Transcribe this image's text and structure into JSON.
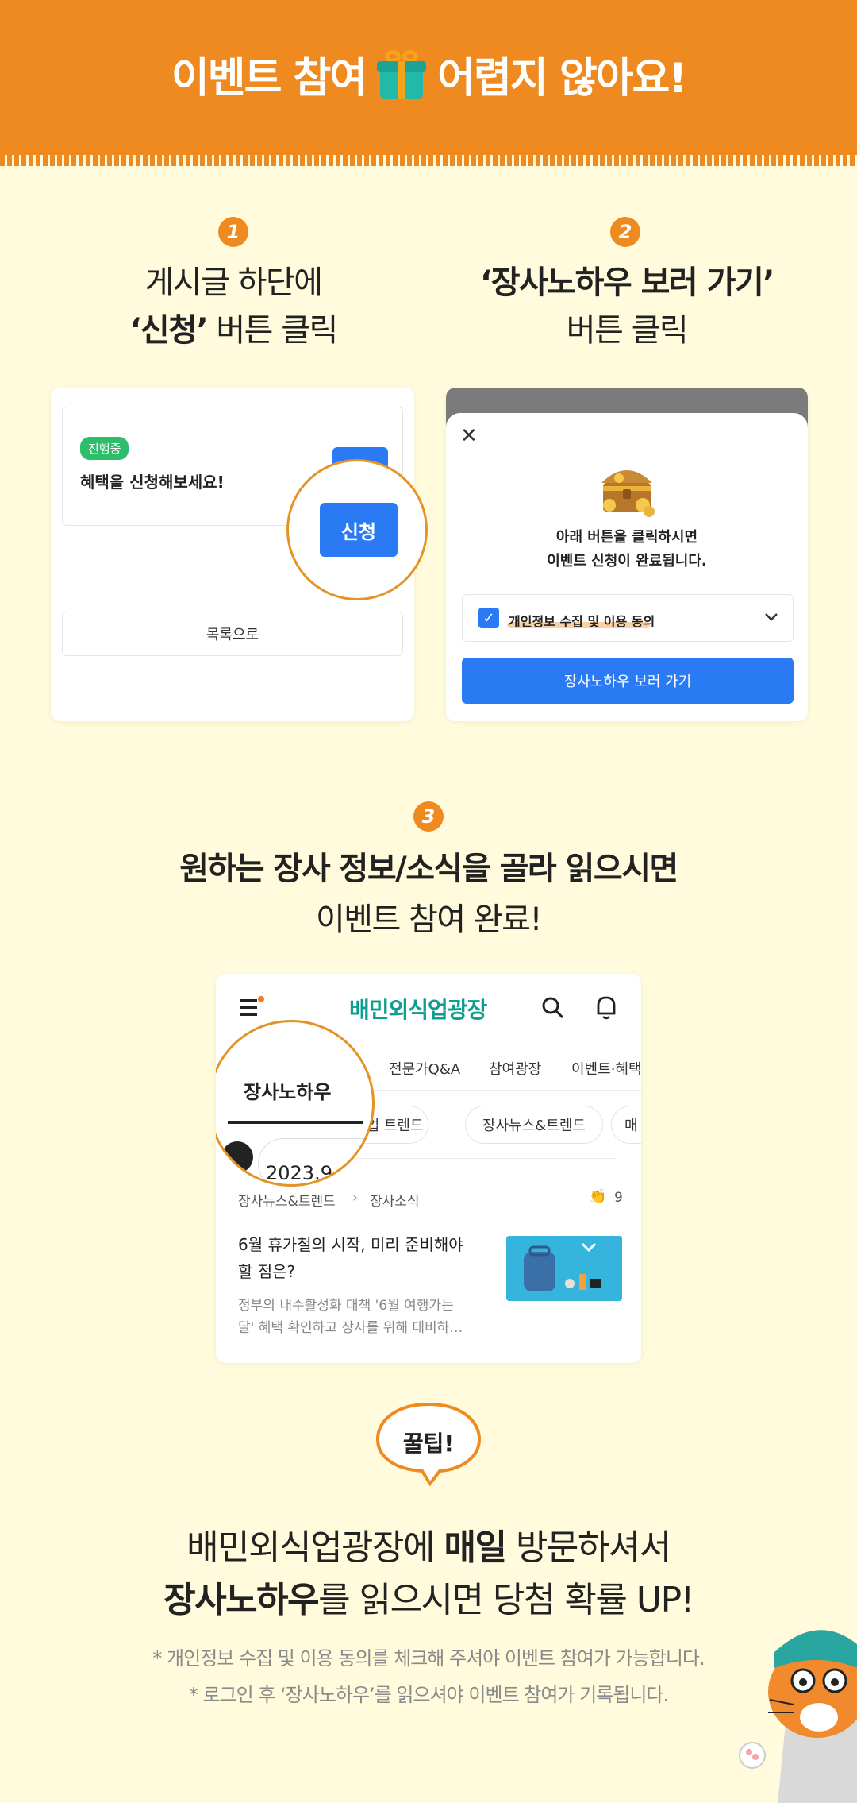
{
  "header": {
    "title_left": "이벤트 참여",
    "title_right": "어렵지 않아요!"
  },
  "step1": {
    "number": "1",
    "line1": "게시글 하단에",
    "line2_bold": "‘신청’",
    "line2_rest": " 버튼 클릭",
    "mock": {
      "status": "진행중",
      "headline": "혜택을 신청해보세요!",
      "apply_button": "신청",
      "list_button": "목록으로"
    }
  },
  "step2": {
    "number": "2",
    "line1": "‘장사노하우 보러 가기’",
    "line2": "버튼 클릭",
    "mock": {
      "close": "✕",
      "message_line1": "아래 버튼을 클릭하시면",
      "message_line2": "이벤트 신청이 완료됩니다.",
      "consent_label": "개인정보 수집 및 이용 동의",
      "cta_button": "장사노하우 보러 가기"
    }
  },
  "step3": {
    "number": "3",
    "line1": "원하는 장사 정보/소식을 골라 읽으시면",
    "line2": "이벤트 참여 완료!",
    "mock": {
      "app_title": "배민외식업광장",
      "tabs": [
        "장사노하우",
        "전문가Q&A",
        "참여광장",
        "이벤트·혜택"
      ],
      "chips": [
        "외식업 트렌드",
        "장사뉴스&트렌드",
        "매"
      ],
      "date_partial": "2023.9",
      "breadcrumb_parent": "장사뉴스&트렌드",
      "breadcrumb_child": "장사소식",
      "like_count": "9",
      "article_title_line1": "6월 휴가철의 시작, 미리 준비해야",
      "article_title_line2": "할 점은?",
      "article_summary_line1": "정부의 내수활성화 대책 '6월 여행가는",
      "article_summary_line2": "달' 혜택 확인하고 장사를 위해 대비하…"
    }
  },
  "tip": {
    "bubble": "꿀팁!",
    "line1_pre": "배민외식업광장에 ",
    "line1_bold": "매일",
    "line1_post": " 방문하셔서",
    "line2_bold": "장사노하우",
    "line2_post": "를 읽으시면 당첨 확률 UP!",
    "note1": "* 개인정보 수집 및 이용 동의를 체크해 주셔야 이벤트 참여가 가능합니다.",
    "note2": "* 로그인 후 ‘장사노하우’를 읽으셔야 이벤트 참여가 기록됩니다."
  },
  "colors": {
    "orange": "#EE8A1F",
    "cream": "#FFFBDC",
    "blue": "#2A7AF4",
    "green": "#2DBE6C",
    "teal": "#0E9E8F"
  }
}
